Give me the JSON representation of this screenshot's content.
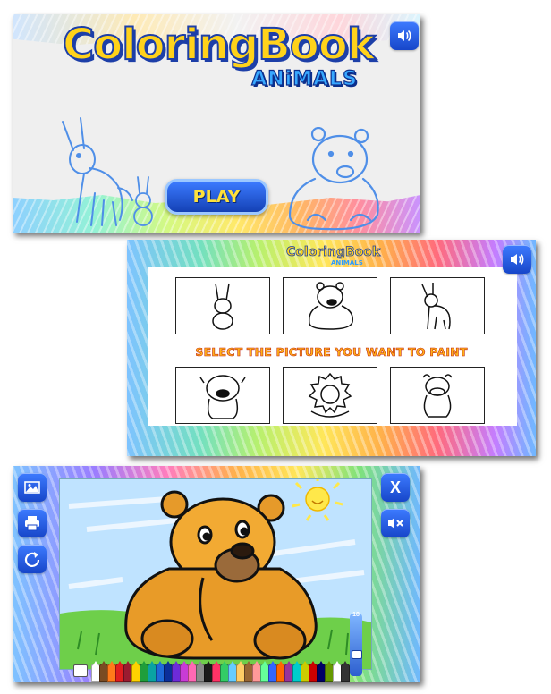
{
  "screen1": {
    "logo_main": "ColoringBook",
    "logo_sub": "ANiMALS",
    "play_label": "PLAY",
    "sound_icon": "speaker-icon"
  },
  "screen2": {
    "logo_main": "ColoringBook",
    "logo_sub": "ANIMALS",
    "instruction": "SELECT THE PICTURE YOU WANT TO PAINT",
    "sound_icon": "speaker-icon",
    "thumbnails": [
      "rabbit",
      "bear",
      "donkey",
      "bulldog",
      "lion",
      "cow"
    ]
  },
  "screen3": {
    "left_tools": [
      "image-icon",
      "print-icon",
      "reset-icon"
    ],
    "right_tools": [
      "close-icon",
      "mute-icon"
    ],
    "close_label": "X",
    "brush_size": "18",
    "brush_size_level": 0.4,
    "crayon_colors": [
      "#ffffff",
      "#7a4b22",
      "#ff7a1a",
      "#e01e1e",
      "#9b1b30",
      "#ffd200",
      "#1f9e3a",
      "#0aa3a3",
      "#1e6ad8",
      "#0b2f9a",
      "#6d2bd9",
      "#c93bd6",
      "#ff69b4",
      "#8a8a8a",
      "#1b1b1b",
      "#ff3366",
      "#33cc66",
      "#66ccff",
      "#ffcc66",
      "#996633",
      "#ff9999",
      "#66ff99",
      "#3366ff",
      "#ff6600",
      "#993399",
      "#00cccc",
      "#cccc00",
      "#cc0000",
      "#000066",
      "#669900",
      "#ffffff",
      "#333333"
    ]
  }
}
